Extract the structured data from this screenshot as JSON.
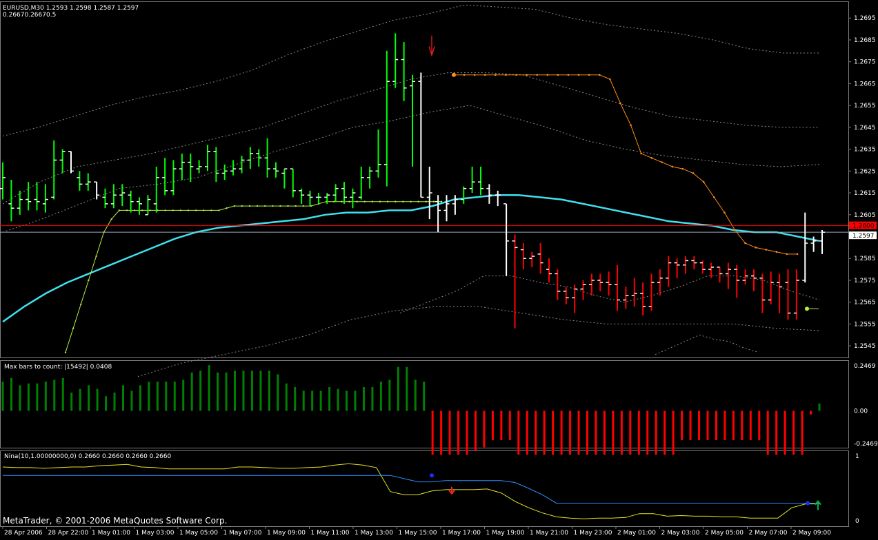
{
  "header": {
    "symbol_line": "EURUSD,M30  1.2593 1.2598 1.2587 1.2597",
    "sub_line": "0.26670.26670.5"
  },
  "colors": {
    "bg": "#000000",
    "grid_border": "#7f7f7f",
    "bull_bar": "#00ff00",
    "bear_bar": "#ff0000",
    "neutral_bar": "#ffffff",
    "ma_line": "#40e0f0",
    "band_line": "#8a8a8a",
    "orange_stop": "#ff8c1a",
    "yellow_stop": "#b8f040",
    "hist_up": "#008000",
    "hist_down": "#ff0000",
    "nina_yellow": "#e6e620",
    "nina_blue": "#3090ff",
    "ref_red": "#ff0000",
    "ref_gray": "#9aa8b8",
    "text": "#ffffff"
  },
  "price_axis": {
    "labels": [
      "1.2695",
      "1.2685",
      "1.2675",
      "1.2665",
      "1.2655",
      "1.2645",
      "1.2635",
      "1.2625",
      "1.2615",
      "1.2605",
      "1.2585",
      "1.2575",
      "1.2565",
      "1.2555",
      "1.2545"
    ],
    "bid_label": "1.2597",
    "ask_label": "1.2600"
  },
  "time_axis": {
    "labels": [
      "28 Apr 2006",
      "28 Apr 22:00",
      "1 May 01:00",
      "1 May 03:00",
      "1 May 05:00",
      "1 May 07:00",
      "1 May 09:00",
      "1 May 11:00",
      "1 May 13:00",
      "1 May 15:00",
      "1 May 17:00",
      "1 May 19:00",
      "1 May 21:00",
      "1 May 23:00",
      "2 May 01:00",
      "2 May 03:00",
      "2 May 05:00",
      "2 May 07:00",
      "2 May 09:00"
    ]
  },
  "indicator1": {
    "label": "Max bars to count: |15492|  0.0408",
    "axis_labels": [
      "0.2469",
      "0.00",
      "-0.2469"
    ]
  },
  "indicator2": {
    "label": "Nina(10,1.00000000,0) 0.2660 0.2660 0.2660 0.2660",
    "axis_labels": [
      "1",
      "0"
    ]
  },
  "copyright": "MetaTrader, © 2001-2006 MetaQuotes Software Corp.",
  "chart_data": {
    "type": "ohlc",
    "symbol": "EURUSD",
    "timeframe": "M30",
    "ylim": [
      1.254,
      1.2702
    ],
    "bars": [
      {
        "o": 1.2617,
        "h": 1.2629,
        "l": 1.2612,
        "c": 1.2622,
        "d": "bull"
      },
      {
        "o": 1.261,
        "h": 1.2621,
        "l": 1.2602,
        "c": 1.2608,
        "d": "bull"
      },
      {
        "o": 1.2608,
        "h": 1.2616,
        "l": 1.2605,
        "c": 1.2612,
        "d": "bull"
      },
      {
        "o": 1.2612,
        "h": 1.262,
        "l": 1.2607,
        "c": 1.2611,
        "d": "bull"
      },
      {
        "o": 1.2612,
        "h": 1.262,
        "l": 1.2607,
        "c": 1.2611,
        "d": "bull"
      },
      {
        "o": 1.261,
        "h": 1.2619,
        "l": 1.2606,
        "c": 1.2612,
        "d": "bull"
      },
      {
        "o": 1.2613,
        "h": 1.2639,
        "l": 1.2612,
        "c": 1.263,
        "d": "bull"
      },
      {
        "o": 1.263,
        "h": 1.2635,
        "l": 1.2624,
        "c": 1.2634,
        "d": "bull"
      },
      {
        "o": 1.2634,
        "h": 1.2634,
        "l": 1.2624,
        "c": 1.2625,
        "d": "neutral"
      },
      {
        "o": 1.2622,
        "h": 1.2625,
        "l": 1.2616,
        "c": 1.2619,
        "d": "bull"
      },
      {
        "o": 1.2619,
        "h": 1.2624,
        "l": 1.2616,
        "c": 1.262,
        "d": "bull"
      },
      {
        "o": 1.262,
        "h": 1.262,
        "l": 1.2612,
        "c": 1.2614,
        "d": "neutral"
      },
      {
        "o": 1.2613,
        "h": 1.2617,
        "l": 1.2608,
        "c": 1.261,
        "d": "bull"
      },
      {
        "o": 1.261,
        "h": 1.2619,
        "l": 1.2608,
        "c": 1.2614,
        "d": "bull"
      },
      {
        "o": 1.2614,
        "h": 1.2619,
        "l": 1.2609,
        "c": 1.2615,
        "d": "bull"
      },
      {
        "o": 1.2614,
        "h": 1.2616,
        "l": 1.2606,
        "c": 1.2611,
        "d": "bull"
      },
      {
        "o": 1.2611,
        "h": 1.2613,
        "l": 1.2605,
        "c": 1.261,
        "d": "bull"
      },
      {
        "o": 1.2605,
        "h": 1.2614,
        "l": 1.2605,
        "c": 1.2612,
        "d": "bull"
      },
      {
        "o": 1.261,
        "h": 1.2627,
        "l": 1.2606,
        "c": 1.2622,
        "d": "bull"
      },
      {
        "o": 1.2622,
        "h": 1.2631,
        "l": 1.2614,
        "c": 1.2616,
        "d": "bull"
      },
      {
        "o": 1.2616,
        "h": 1.263,
        "l": 1.2614,
        "c": 1.2626,
        "d": "bull"
      },
      {
        "o": 1.2626,
        "h": 1.2633,
        "l": 1.2621,
        "c": 1.2629,
        "d": "bull"
      },
      {
        "o": 1.2629,
        "h": 1.2633,
        "l": 1.262,
        "c": 1.2627,
        "d": "bull"
      },
      {
        "o": 1.2626,
        "h": 1.263,
        "l": 1.2624,
        "c": 1.2627,
        "d": "bull"
      },
      {
        "o": 1.2627,
        "h": 1.2637,
        "l": 1.2625,
        "c": 1.2634,
        "d": "bull"
      },
      {
        "o": 1.2634,
        "h": 1.2636,
        "l": 1.262,
        "c": 1.2624,
        "d": "bull"
      },
      {
        "o": 1.2624,
        "h": 1.2628,
        "l": 1.2621,
        "c": 1.2625,
        "d": "bull"
      },
      {
        "o": 1.2625,
        "h": 1.263,
        "l": 1.2623,
        "c": 1.2626,
        "d": "bull"
      },
      {
        "o": 1.2626,
        "h": 1.2632,
        "l": 1.2624,
        "c": 1.263,
        "d": "bull"
      },
      {
        "o": 1.263,
        "h": 1.2636,
        "l": 1.2626,
        "c": 1.2633,
        "d": "bull"
      },
      {
        "o": 1.2633,
        "h": 1.2635,
        "l": 1.2627,
        "c": 1.2631,
        "d": "bull"
      },
      {
        "o": 1.2631,
        "h": 1.264,
        "l": 1.2622,
        "c": 1.2626,
        "d": "bull"
      },
      {
        "o": 1.2626,
        "h": 1.2629,
        "l": 1.2622,
        "c": 1.2625,
        "d": "bull"
      },
      {
        "o": 1.2624,
        "h": 1.2626,
        "l": 1.2617,
        "c": 1.2626,
        "d": "bull"
      },
      {
        "o": 1.2626,
        "h": 1.2626,
        "l": 1.2613,
        "c": 1.2616,
        "d": "bull"
      },
      {
        "o": 1.2616,
        "h": 1.2617,
        "l": 1.261,
        "c": 1.2614,
        "d": "bull"
      },
      {
        "o": 1.2614,
        "h": 1.2616,
        "l": 1.2609,
        "c": 1.2613,
        "d": "bull"
      },
      {
        "o": 1.2613,
        "h": 1.2615,
        "l": 1.261,
        "c": 1.2613,
        "d": "bull"
      },
      {
        "o": 1.2613,
        "h": 1.2615,
        "l": 1.261,
        "c": 1.2614,
        "d": "bull"
      },
      {
        "o": 1.2614,
        "h": 1.2619,
        "l": 1.2611,
        "c": 1.2617,
        "d": "bull"
      },
      {
        "o": 1.2617,
        "h": 1.262,
        "l": 1.261,
        "c": 1.2613,
        "d": "bull"
      },
      {
        "o": 1.2613,
        "h": 1.2617,
        "l": 1.2608,
        "c": 1.2615,
        "d": "bull"
      },
      {
        "o": 1.2613,
        "h": 1.2627,
        "l": 1.2612,
        "c": 1.2622,
        "d": "bull"
      },
      {
        "o": 1.2622,
        "h": 1.2627,
        "l": 1.2617,
        "c": 1.2625,
        "d": "bull"
      },
      {
        "o": 1.2625,
        "h": 1.2644,
        "l": 1.2622,
        "c": 1.2628,
        "d": "bull"
      },
      {
        "o": 1.2628,
        "h": 1.268,
        "l": 1.2618,
        "c": 1.2666,
        "d": "bull"
      },
      {
        "o": 1.2666,
        "h": 1.2688,
        "l": 1.2663,
        "c": 1.2676,
        "d": "bull"
      },
      {
        "o": 1.2676,
        "h": 1.2684,
        "l": 1.2657,
        "c": 1.2663,
        "d": "bull"
      },
      {
        "o": 1.2664,
        "h": 1.2669,
        "l": 1.2627,
        "c": 1.2666,
        "d": "bull"
      },
      {
        "o": 1.2666,
        "h": 1.267,
        "l": 1.2613,
        "c": 1.2613,
        "d": "neutral"
      },
      {
        "o": 1.2613,
        "h": 1.2627,
        "l": 1.2603,
        "c": 1.2615,
        "d": "neutral"
      },
      {
        "o": 1.2611,
        "h": 1.2614,
        "l": 1.2597,
        "c": 1.2607,
        "d": "neutral"
      },
      {
        "o": 1.2607,
        "h": 1.2614,
        "l": 1.2602,
        "c": 1.261,
        "d": "neutral"
      },
      {
        "o": 1.261,
        "h": 1.2614,
        "l": 1.2605,
        "c": 1.2612,
        "d": "neutral"
      },
      {
        "o": 1.2612,
        "h": 1.2618,
        "l": 1.261,
        "c": 1.2617,
        "d": "bull"
      },
      {
        "o": 1.2617,
        "h": 1.2627,
        "l": 1.2615,
        "c": 1.262,
        "d": "bull"
      },
      {
        "o": 1.262,
        "h": 1.2627,
        "l": 1.2614,
        "c": 1.2617,
        "d": "bull"
      },
      {
        "o": 1.2617,
        "h": 1.2619,
        "l": 1.261,
        "c": 1.2614,
        "d": "neutral"
      },
      {
        "o": 1.2614,
        "h": 1.2616,
        "l": 1.2609,
        "c": 1.2614,
        "d": "neutral"
      },
      {
        "o": 1.261,
        "h": 1.261,
        "l": 1.2577,
        "c": 1.2593,
        "d": "neutral"
      },
      {
        "o": 1.2593,
        "h": 1.2596,
        "l": 1.2553,
        "c": 1.259,
        "d": "bear"
      },
      {
        "o": 1.2589,
        "h": 1.2592,
        "l": 1.258,
        "c": 1.2585,
        "d": "bear"
      },
      {
        "o": 1.2585,
        "h": 1.2588,
        "l": 1.2581,
        "c": 1.2586,
        "d": "bear"
      },
      {
        "o": 1.2587,
        "h": 1.2592,
        "l": 1.2578,
        "c": 1.2583,
        "d": "bear"
      },
      {
        "o": 1.258,
        "h": 1.2585,
        "l": 1.2574,
        "c": 1.2578,
        "d": "bear"
      },
      {
        "o": 1.2578,
        "h": 1.258,
        "l": 1.2566,
        "c": 1.257,
        "d": "bear"
      },
      {
        "o": 1.257,
        "h": 1.2572,
        "l": 1.2564,
        "c": 1.2567,
        "d": "bear"
      },
      {
        "o": 1.2567,
        "h": 1.2573,
        "l": 1.256,
        "c": 1.2571,
        "d": "bear"
      },
      {
        "o": 1.2571,
        "h": 1.2575,
        "l": 1.2566,
        "c": 1.2573,
        "d": "bear"
      },
      {
        "o": 1.2573,
        "h": 1.2578,
        "l": 1.2568,
        "c": 1.2575,
        "d": "bear"
      },
      {
        "o": 1.2575,
        "h": 1.2578,
        "l": 1.257,
        "c": 1.2574,
        "d": "bear"
      },
      {
        "o": 1.2574,
        "h": 1.2579,
        "l": 1.2568,
        "c": 1.2573,
        "d": "bear"
      },
      {
        "o": 1.2573,
        "h": 1.2582,
        "l": 1.2561,
        "c": 1.2566,
        "d": "bear"
      },
      {
        "o": 1.2566,
        "h": 1.2572,
        "l": 1.2562,
        "c": 1.2568,
        "d": "bear"
      },
      {
        "o": 1.2568,
        "h": 1.2576,
        "l": 1.2563,
        "c": 1.2569,
        "d": "bear"
      },
      {
        "o": 1.2569,
        "h": 1.2574,
        "l": 1.2559,
        "c": 1.2563,
        "d": "bear"
      },
      {
        "o": 1.2563,
        "h": 1.2578,
        "l": 1.2561,
        "c": 1.2574,
        "d": "bear"
      },
      {
        "o": 1.2574,
        "h": 1.258,
        "l": 1.2568,
        "c": 1.2576,
        "d": "bear"
      },
      {
        "o": 1.2576,
        "h": 1.2586,
        "l": 1.2572,
        "c": 1.2583,
        "d": "bear"
      },
      {
        "o": 1.2583,
        "h": 1.2585,
        "l": 1.2576,
        "c": 1.2582,
        "d": "bear"
      },
      {
        "o": 1.2582,
        "h": 1.2586,
        "l": 1.2578,
        "c": 1.2584,
        "d": "bear"
      },
      {
        "o": 1.2584,
        "h": 1.2586,
        "l": 1.258,
        "c": 1.2583,
        "d": "bear"
      },
      {
        "o": 1.2583,
        "h": 1.2584,
        "l": 1.2578,
        "c": 1.258,
        "d": "bear"
      },
      {
        "o": 1.258,
        "h": 1.2583,
        "l": 1.2576,
        "c": 1.2581,
        "d": "bear"
      },
      {
        "o": 1.2581,
        "h": 1.2581,
        "l": 1.2574,
        "c": 1.2578,
        "d": "bear"
      },
      {
        "o": 1.2578,
        "h": 1.2583,
        "l": 1.2571,
        "c": 1.258,
        "d": "bear"
      },
      {
        "o": 1.258,
        "h": 1.2582,
        "l": 1.2567,
        "c": 1.2575,
        "d": "bear"
      },
      {
        "o": 1.2575,
        "h": 1.258,
        "l": 1.2573,
        "c": 1.2577,
        "d": "bear"
      },
      {
        "o": 1.2577,
        "h": 1.258,
        "l": 1.257,
        "c": 1.2576,
        "d": "bear"
      },
      {
        "o": 1.2576,
        "h": 1.2578,
        "l": 1.256,
        "c": 1.2566,
        "d": "bear"
      },
      {
        "o": 1.2566,
        "h": 1.2579,
        "l": 1.2564,
        "c": 1.2574,
        "d": "bear"
      },
      {
        "o": 1.2574,
        "h": 1.2578,
        "l": 1.256,
        "c": 1.2572,
        "d": "bear"
      },
      {
        "o": 1.2574,
        "h": 1.258,
        "l": 1.2557,
        "c": 1.256,
        "d": "bear"
      },
      {
        "o": 1.256,
        "h": 1.258,
        "l": 1.2557,
        "c": 1.2575,
        "d": "bear"
      },
      {
        "o": 1.2575,
        "h": 1.2606,
        "l": 1.2574,
        "c": 1.2592,
        "d": "neutral"
      },
      {
        "o": 1.2592,
        "h": 1.2595,
        "l": 1.2588,
        "c": 1.2593,
        "d": "neutral"
      },
      {
        "o": 1.2593,
        "h": 1.2598,
        "l": 1.2587,
        "c": 1.2597,
        "d": "neutral"
      }
    ],
    "ma_line": [
      1.2556,
      1.2563,
      1.2569,
      1.2574,
      1.2578,
      1.2582,
      1.2586,
      1.259,
      1.2594,
      1.2597,
      1.2599,
      1.26,
      1.2601,
      1.2602,
      1.2603,
      1.2605,
      1.2606,
      1.2606,
      1.2607,
      1.2607,
      1.2609,
      1.2612,
      1.2613,
      1.2614,
      1.2614,
      1.2613,
      1.2612,
      1.261,
      1.2608,
      1.2606,
      1.2604,
      1.2602,
      1.2601,
      1.26,
      1.2598,
      1.2597,
      1.2597,
      1.2595,
      1.2593
    ],
    "upper_band_1": [
      1.2641,
      1.2645,
      1.265,
      1.2655,
      1.2659,
      1.2662,
      1.2666,
      1.2671,
      1.2678,
      1.2684,
      1.2689,
      1.2694,
      1.2697,
      1.2701,
      1.27,
      1.2699,
      1.2695,
      1.2692,
      1.269,
      1.2688,
      1.2685,
      1.2681,
      1.2679,
      1.2679
    ],
    "upper_band_2": [
      1.261,
      1.262,
      1.2627,
      1.263,
      1.2633,
      1.2637,
      1.2641,
      1.2645,
      1.2651,
      1.2657,
      1.2662,
      1.2667,
      1.267,
      1.267,
      1.2669,
      1.2664,
      1.2659,
      1.2654,
      1.265,
      1.2648,
      1.2646,
      1.2645,
      1.2645
    ],
    "upper_band_3": [
      1.2597,
      1.2603,
      1.261,
      1.2617,
      1.2619,
      1.2622,
      1.2628,
      1.2634,
      1.2639,
      1.2645,
      1.2648,
      1.2652,
      1.2655,
      1.265,
      1.2645,
      1.2639,
      1.2635,
      1.2632,
      1.263,
      1.2628,
      1.2627,
      1.2628
    ],
    "lower_band_1": [
      1.256,
      1.2565,
      1.257,
      1.2577,
      1.2577,
      1.2574,
      1.2572,
      1.2568,
      1.2565,
      1.2568,
      1.2572,
      1.2577,
      1.2577,
      1.2575,
      1.257,
      1.2566
    ],
    "lower_band_2": [
      1.2531,
      1.2537,
      1.2541,
      1.2545,
      1.255,
      1.2557,
      1.2561,
      1.2563,
      1.2563,
      1.256,
      1.2557,
      1.2555,
      1.2555,
      1.2555,
      1.2555,
      1.2553,
      1.2552
    ],
    "lower_band_3": [
      1.2541,
      1.2544,
      1.2547,
      1.255,
      1.2548,
      1.2547,
      1.2544,
      1.2542
    ],
    "orange_stop": [
      1.2669,
      1.2669,
      1.2669,
      1.2669,
      1.2669,
      1.2669,
      1.2669,
      1.2669,
      1.2669,
      1.2669,
      1.2669,
      1.2669,
      1.2669,
      1.2669,
      1.2669,
      1.2667,
      1.2656,
      1.2646,
      1.2633,
      1.2631,
      1.2629,
      1.2627,
      1.2626,
      1.2624,
      1.262,
      1.2613,
      1.2606,
      1.2598,
      1.2592,
      1.259,
      1.2589,
      1.2588,
      1.2587,
      1.2587
    ],
    "yellow_stop": [
      1.2542,
      1.2553,
      1.2564,
      1.2575,
      1.2586,
      1.2597,
      1.2603,
      1.2607,
      1.2607,
      1.2607,
      1.2607,
      1.2607,
      1.2607,
      1.2607,
      1.2607,
      1.2607,
      1.2607,
      1.2607,
      1.2607,
      1.2607,
      1.2607,
      1.2608,
      1.2609,
      1.2609,
      1.2609,
      1.2609,
      1.2609,
      1.2609,
      1.2609,
      1.2609,
      1.2609,
      1.2609,
      1.2609,
      1.261,
      1.2611,
      1.2611,
      1.2611,
      1.2611,
      1.2611,
      1.2611,
      1.2611,
      1.2611,
      1.2611,
      1.2611,
      1.2611,
      1.2611,
      1.2611,
      1.2611,
      1.2611,
      1.2611
    ],
    "ref_lines": {
      "ask": 1.26,
      "bid": 1.2597
    },
    "histogram": [
      0.16,
      0.18,
      0.14,
      0.15,
      0.15,
      0.16,
      0.17,
      0.18,
      0.1,
      0.12,
      0.14,
      0.12,
      0.08,
      0.1,
      0.14,
      0.11,
      0.14,
      0.16,
      0.16,
      0.16,
      0.16,
      0.17,
      0.21,
      0.22,
      0.25,
      0.21,
      0.21,
      0.22,
      0.22,
      0.22,
      0.22,
      0.22,
      0.2,
      0.15,
      0.13,
      0.11,
      0.11,
      0.11,
      0.13,
      0.12,
      0.11,
      0.11,
      0.13,
      0.13,
      0.16,
      0.17,
      0.24,
      0.24,
      0.17,
      0.16,
      -0.24,
      -0.24,
      -0.24,
      -0.24,
      -0.24,
      -0.22,
      -0.2,
      -0.16,
      -0.16,
      -0.16,
      -0.24,
      -0.24,
      -0.24,
      -0.24,
      -0.24,
      -0.24,
      -0.24,
      -0.24,
      -0.24,
      -0.24,
      -0.24,
      -0.24,
      -0.24,
      -0.24,
      -0.24,
      -0.24,
      -0.24,
      -0.24,
      -0.24,
      -0.16,
      -0.16,
      -0.16,
      -0.16,
      -0.16,
      -0.16,
      -0.16,
      -0.16,
      -0.16,
      -0.16,
      -0.24,
      -0.24,
      -0.24,
      -0.24,
      -0.24,
      -0.02,
      0.04
    ],
    "nina_yellow": [
      0.83,
      0.82,
      0.82,
      0.81,
      0.82,
      0.83,
      0.83,
      0.85,
      0.86,
      0.87,
      0.83,
      0.82,
      0.8,
      0.8,
      0.8,
      0.8,
      0.8,
      0.83,
      0.83,
      0.82,
      0.81,
      0.81,
      0.82,
      0.83,
      0.86,
      0.88,
      0.86,
      0.82,
      0.45,
      0.4,
      0.4,
      0.46,
      0.48,
      0.48,
      0.48,
      0.49,
      0.43,
      0.3,
      0.2,
      0.12,
      0.06,
      0.04,
      0.03,
      0.04,
      0.04,
      0.05,
      0.11,
      0.11,
      0.07,
      0.08,
      0.07,
      0.07,
      0.06,
      0.06,
      0.04,
      0.04,
      0.04,
      0.2,
      0.26,
      0.26
    ],
    "nina_blue": [
      0.7,
      0.7,
      0.7,
      0.7,
      0.7,
      0.7,
      0.7,
      0.7,
      0.7,
      0.7,
      0.7,
      0.7,
      0.7,
      0.7,
      0.7,
      0.7,
      0.7,
      0.7,
      0.7,
      0.7,
      0.7,
      0.7,
      0.7,
      0.7,
      0.7,
      0.7,
      0.7,
      0.7,
      0.7,
      0.65,
      0.6,
      0.6,
      0.62,
      0.62,
      0.62,
      0.62,
      0.62,
      0.59,
      0.5,
      0.4,
      0.27,
      0.27,
      0.27,
      0.27,
      0.27,
      0.27,
      0.27,
      0.27,
      0.27,
      0.27,
      0.27,
      0.27,
      0.27,
      0.27,
      0.27,
      0.27,
      0.27,
      0.27,
      0.27,
      0.27
    ]
  }
}
